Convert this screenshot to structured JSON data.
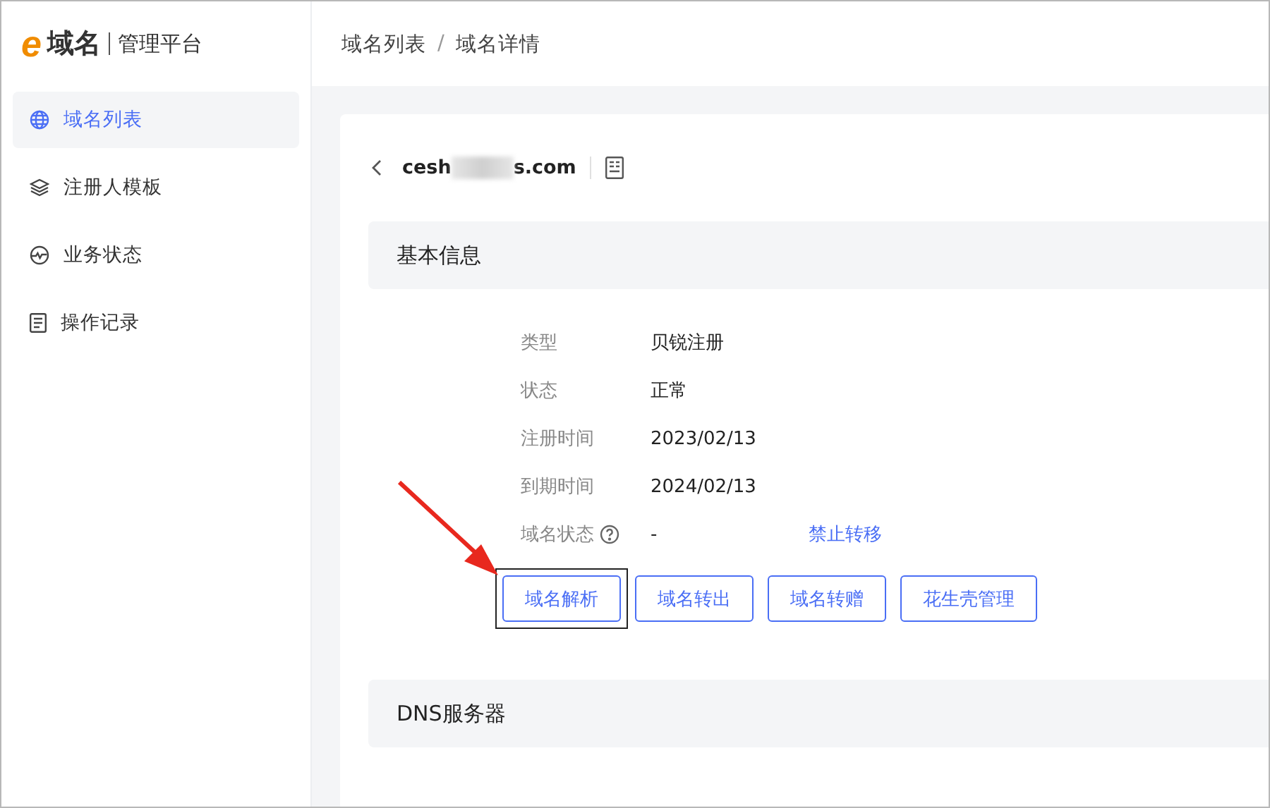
{
  "logo": {
    "mark": "e",
    "name": "域名",
    "subtitle": "管理平台"
  },
  "sidebar": {
    "items": [
      {
        "label": "域名列表",
        "selected": true
      },
      {
        "label": "注册人模板",
        "selected": false
      },
      {
        "label": "业务状态",
        "selected": false
      },
      {
        "label": "操作记录",
        "selected": false
      }
    ]
  },
  "breadcrumb": [
    "域名列表",
    "域名详情"
  ],
  "breadcrumb_separator": "/",
  "domain": {
    "prefix": "cesh",
    "suffix": "s.com",
    "redacted": true
  },
  "basic_info": {
    "title": "基本信息",
    "rows": [
      {
        "label": "类型",
        "value": "贝锐注册",
        "help": false
      },
      {
        "label": "状态",
        "value": "正常",
        "help": false
      },
      {
        "label": "注册时间",
        "value": "2023/02/13",
        "help": false
      },
      {
        "label": "到期时间",
        "value": "2024/02/13",
        "help": false
      },
      {
        "label": "域名状态",
        "value": "-",
        "help": true,
        "link": "禁止转移"
      }
    ]
  },
  "actions": [
    {
      "label": "域名解析",
      "highlighted": true
    },
    {
      "label": "域名转出",
      "highlighted": false
    },
    {
      "label": "域名转赠",
      "highlighted": false
    },
    {
      "label": "花生壳管理",
      "highlighted": false
    }
  ],
  "dns_section": {
    "title": "DNS服务器"
  }
}
